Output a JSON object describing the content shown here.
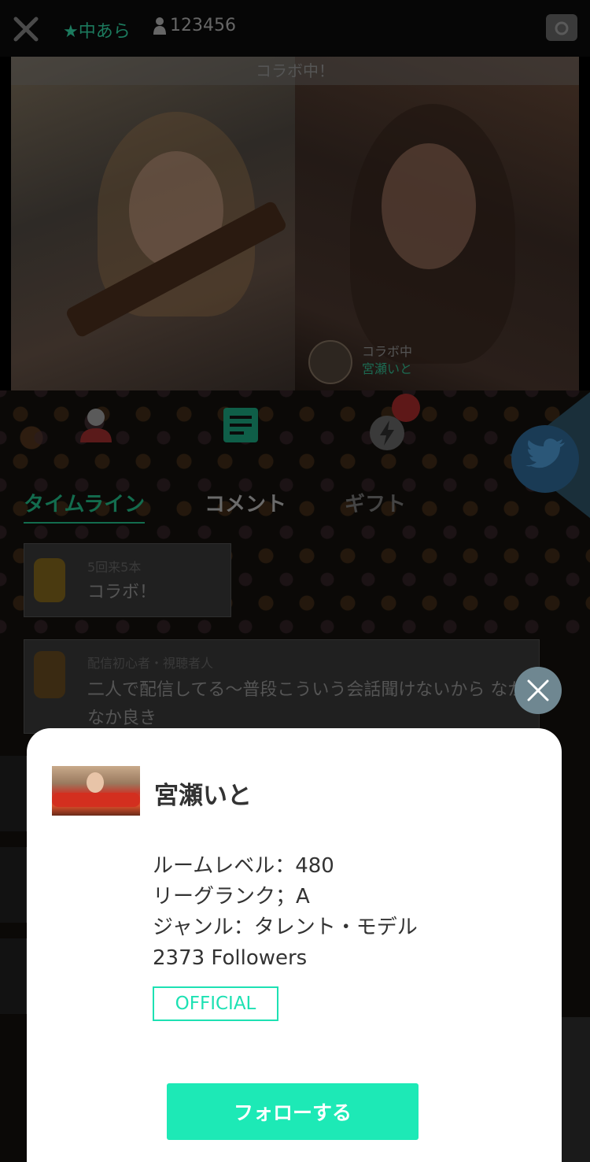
{
  "topbar": {
    "live_status": "★中あら",
    "viewer_count": "123456"
  },
  "video": {
    "collab_banner": "コラボ中！",
    "guest_status": "コラボ中",
    "guest_name": "宮瀬いと"
  },
  "tabs": [
    {
      "label": "タイムライン",
      "active": true
    },
    {
      "label": "コメント",
      "active": false
    },
    {
      "label": "ギフト",
      "active": false
    }
  ],
  "timeline": [
    {
      "meta": "5回来5本",
      "text": "コラボ！"
    },
    {
      "meta": "配信初心者・視聴者人",
      "text": "二人で配信してる〜普段こういう会話聞けないから なかなか良き"
    }
  ],
  "modal": {
    "name": "宮瀬いと",
    "room_level": "ルームレベル：480",
    "league_rank": "リーグランク；A",
    "genre": "ジャンル：タレント・モデル",
    "followers": "2373 Followers",
    "badge": "OFFICIAL",
    "follow_label": "フォローする"
  },
  "colors": {
    "accent": "#1de9b6",
    "badge_border": "#1de1b3",
    "close_button": "#6f8791",
    "dim_background": "#000000"
  },
  "icons": [
    "close-icon",
    "person-icon",
    "camera-icon",
    "profile-tab-icon",
    "timeline-tab-icon",
    "gift-tab-icon",
    "twitter-icon",
    "modal-close-icon"
  ]
}
